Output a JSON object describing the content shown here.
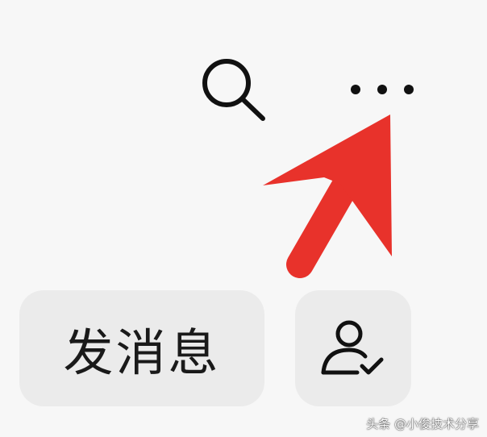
{
  "toolbar": {
    "search_icon": "search-icon",
    "more_icon": "more-dots-icon"
  },
  "annotation": {
    "arrow_color": "#e8322b",
    "points_to": "more-button"
  },
  "actions": {
    "message_label": "发消息",
    "follow_icon": "user-check-icon"
  },
  "watermark": {
    "text": "头条 @小俊技术分享"
  },
  "colors": {
    "background": "#f7f7f7",
    "button_bg": "#ebebeb",
    "icon": "#111111",
    "arrow": "#e8322b"
  }
}
